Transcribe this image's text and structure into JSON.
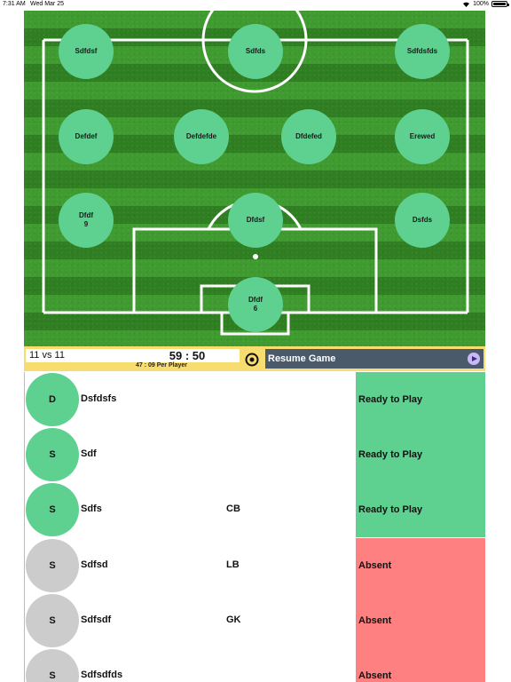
{
  "status_bar": {
    "time": "7:31 AM",
    "date": "Wed Mar 25",
    "battery": "100%"
  },
  "colors": {
    "active_player": "#5ed08f",
    "inactive_player": "#cccccc",
    "ready": "#5ed08f",
    "absent": "#fe8080",
    "control_bar": "#f7dc6f",
    "resume_button": "#4a5a6b"
  },
  "field": {
    "players": [
      {
        "name": "Sdfdsf",
        "number": ""
      },
      {
        "name": "Sdfds",
        "number": ""
      },
      {
        "name": "Sdfdsfds",
        "number": ""
      },
      {
        "name": "Defdef",
        "number": ""
      },
      {
        "name": "Defdefde",
        "number": ""
      },
      {
        "name": "Dfdefed",
        "number": ""
      },
      {
        "name": "Erewed",
        "number": ""
      },
      {
        "name": "Dfdf",
        "number": "9"
      },
      {
        "name": "Dfdsf",
        "number": ""
      },
      {
        "name": "Dsfds",
        "number": ""
      },
      {
        "name": "Dfdf",
        "number": "6"
      }
    ]
  },
  "controls": {
    "format": "11 vs 11",
    "timer": "59 : 50",
    "per_player": "47 : 09 Per Player",
    "resume_label": "Resume Game"
  },
  "roster": [
    {
      "initial": "D",
      "name": "Dsfdsfs",
      "position": "",
      "status": "Ready to Play",
      "state": "ready"
    },
    {
      "initial": "S",
      "name": "Sdf",
      "position": "",
      "status": "Ready to Play",
      "state": "ready"
    },
    {
      "initial": "S",
      "name": "Sdfs",
      "position": "CB",
      "status": "Ready to Play",
      "state": "ready"
    },
    {
      "initial": "S",
      "name": "Sdfsd",
      "position": "LB",
      "status": "Absent",
      "state": "absent"
    },
    {
      "initial": "S",
      "name": "Sdfsdf",
      "position": "GK",
      "status": "Absent",
      "state": "absent"
    },
    {
      "initial": "S",
      "name": "Sdfsdfds",
      "position": "",
      "status": "Absent",
      "state": "absent"
    }
  ]
}
